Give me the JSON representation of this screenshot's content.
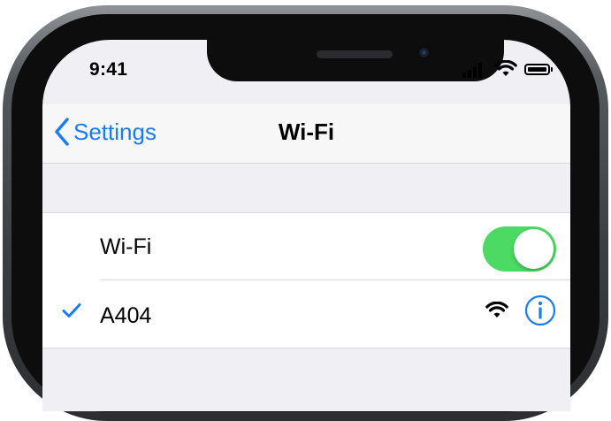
{
  "status_bar": {
    "time": "9:41",
    "icons": [
      "cellular-signal-icon",
      "wifi-icon",
      "battery-icon"
    ],
    "battery_level": 1.0
  },
  "nav": {
    "back_label": "Settings",
    "title": "Wi-Fi"
  },
  "wifi_toggle": {
    "label": "Wi-Fi",
    "on": true
  },
  "networks": [
    {
      "name": "A404",
      "connected": true,
      "icons": [
        "checkmark-icon",
        "wifi-signal-icon",
        "info-icon"
      ]
    }
  ],
  "colors": {
    "accent": "#1a7cf5",
    "toggle_on": "#4cd964",
    "background": "#efeff4"
  }
}
